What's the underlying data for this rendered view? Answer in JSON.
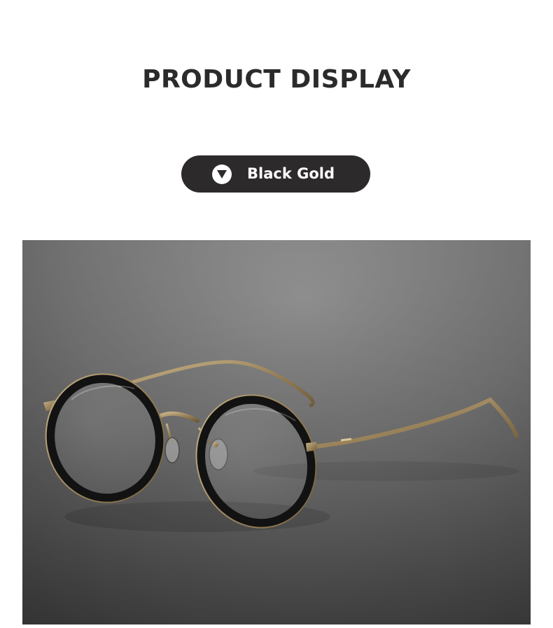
{
  "header": {
    "title": "PRODUCT DISPLAY"
  },
  "variant": {
    "label": "Black Gold",
    "icon": "triangle-down-icon"
  },
  "product_image": {
    "subject": "eyeglasses-icon",
    "colors": {
      "frame_rim": "#151515",
      "metal": "#a8916a",
      "background_light": "#8a8a8a",
      "background_dark": "#4a4a4a"
    }
  },
  "colors": {
    "pill_background": "#2d2a2b",
    "title_text": "#2b2b2b"
  }
}
